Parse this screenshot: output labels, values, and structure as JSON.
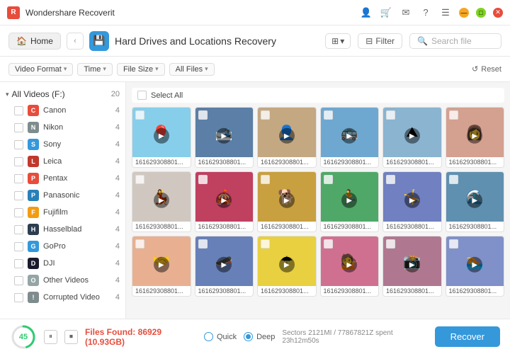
{
  "app": {
    "title": "Wondershare Recoverit",
    "icon_label": "R"
  },
  "title_bar": {
    "controls": [
      "minimize",
      "maximize",
      "close"
    ]
  },
  "nav": {
    "home_label": "Home",
    "back_arrow": "‹",
    "title_icon": "💾",
    "title_text": "Hard Drives and Locations Recovery",
    "view_icon": "⊞",
    "filter_label": "Filter",
    "search_placeholder": "Search file"
  },
  "filter_bar": {
    "video_format": "Video Format",
    "time": "Time",
    "file_size": "File Size",
    "all_files": "All Files",
    "select_all": "Select All",
    "reset": "Reset"
  },
  "sidebar": {
    "group_label": "All Videos (F:)",
    "group_count": 20,
    "items": [
      {
        "label": "Canon",
        "count": 4,
        "color": "brand-red",
        "letter": "C"
      },
      {
        "label": "Nikon",
        "count": 4,
        "color": "brand-gray",
        "letter": "N"
      },
      {
        "label": "Sony",
        "count": 4,
        "color": "brand-blue",
        "letter": "S"
      },
      {
        "label": "Leica",
        "count": 4,
        "color": "brand-red2",
        "letter": "L"
      },
      {
        "label": "Pentax",
        "count": 4,
        "color": "brand-red",
        "letter": "P"
      },
      {
        "label": "Panasonic",
        "count": 4,
        "color": "brand-lblue",
        "letter": "P"
      },
      {
        "label": "Fujifilm",
        "count": 4,
        "color": "brand-orange2",
        "letter": "F"
      },
      {
        "label": "Hasselblad",
        "count": 4,
        "color": "brand-dark",
        "letter": "H"
      },
      {
        "label": "GoPro",
        "count": 4,
        "color": "brand-blue",
        "letter": "G"
      },
      {
        "label": "DJI",
        "count": 4,
        "color": "brand-dji",
        "letter": "D"
      },
      {
        "label": "Other Videos",
        "count": 4,
        "color": "brand-other",
        "letter": "O"
      },
      {
        "label": "Corrupted Video",
        "count": 4,
        "color": "brand-gray",
        "letter": "!"
      }
    ]
  },
  "thumbnails": [
    {
      "id": 1,
      "color": "#87CEEB",
      "emoji": "🎈",
      "label": "161629308801..."
    },
    {
      "id": 2,
      "color": "#5b7fa6",
      "emoji": "🎿",
      "label": "161629308801..."
    },
    {
      "id": 3,
      "color": "#c4a882",
      "emoji": "👤",
      "label": "161629308801..."
    },
    {
      "id": 4,
      "color": "#6ea8d0",
      "emoji": "🚌",
      "label": "161629308801..."
    },
    {
      "id": 5,
      "color": "#8ab4d0",
      "emoji": "⛰",
      "label": "161629308801..."
    },
    {
      "id": 6,
      "color": "#d4a090",
      "emoji": "👩",
      "label": "161629308801..."
    },
    {
      "id": 7,
      "color": "#d0c8c0",
      "emoji": "💃",
      "label": "161629308801..."
    },
    {
      "id": 8,
      "color": "#c04060",
      "emoji": "🎪",
      "label": "161629308801..."
    },
    {
      "id": 9,
      "color": "#c8a040",
      "emoji": "🐕",
      "label": "161629308801..."
    },
    {
      "id": 10,
      "color": "#50a868",
      "emoji": "🏃",
      "label": "161629308801..."
    },
    {
      "id": 11,
      "color": "#7080c0",
      "emoji": "🤸",
      "label": "161629308801..."
    },
    {
      "id": 12,
      "color": "#6090b0",
      "emoji": "🌊",
      "label": "161629308801..."
    },
    {
      "id": 13,
      "color": "#e8b090",
      "emoji": "🤝",
      "label": "161629308801..."
    },
    {
      "id": 14,
      "color": "#6880b8",
      "emoji": "🛹",
      "label": "161629308801..."
    },
    {
      "id": 15,
      "color": "#e8d040",
      "emoji": "☂",
      "label": "161629308801..."
    },
    {
      "id": 16,
      "color": "#d07090",
      "emoji": "💁",
      "label": "161629308801..."
    },
    {
      "id": 17,
      "color": "#b07890",
      "emoji": "📸",
      "label": "161629308801..."
    },
    {
      "id": 18,
      "color": "#8090c8",
      "emoji": "🏊",
      "label": "161629308801..."
    }
  ],
  "bottom_bar": {
    "progress": 45,
    "files_found_label": "Files Found:",
    "files_count": "86929",
    "files_size": "(10.93GB)",
    "scan_quick_label": "Quick",
    "scan_deep_label": "Deep",
    "scan_info": "Sectors 2121MI / 77867821Z    spent 23h12m50s",
    "recover_label": "Recover"
  }
}
